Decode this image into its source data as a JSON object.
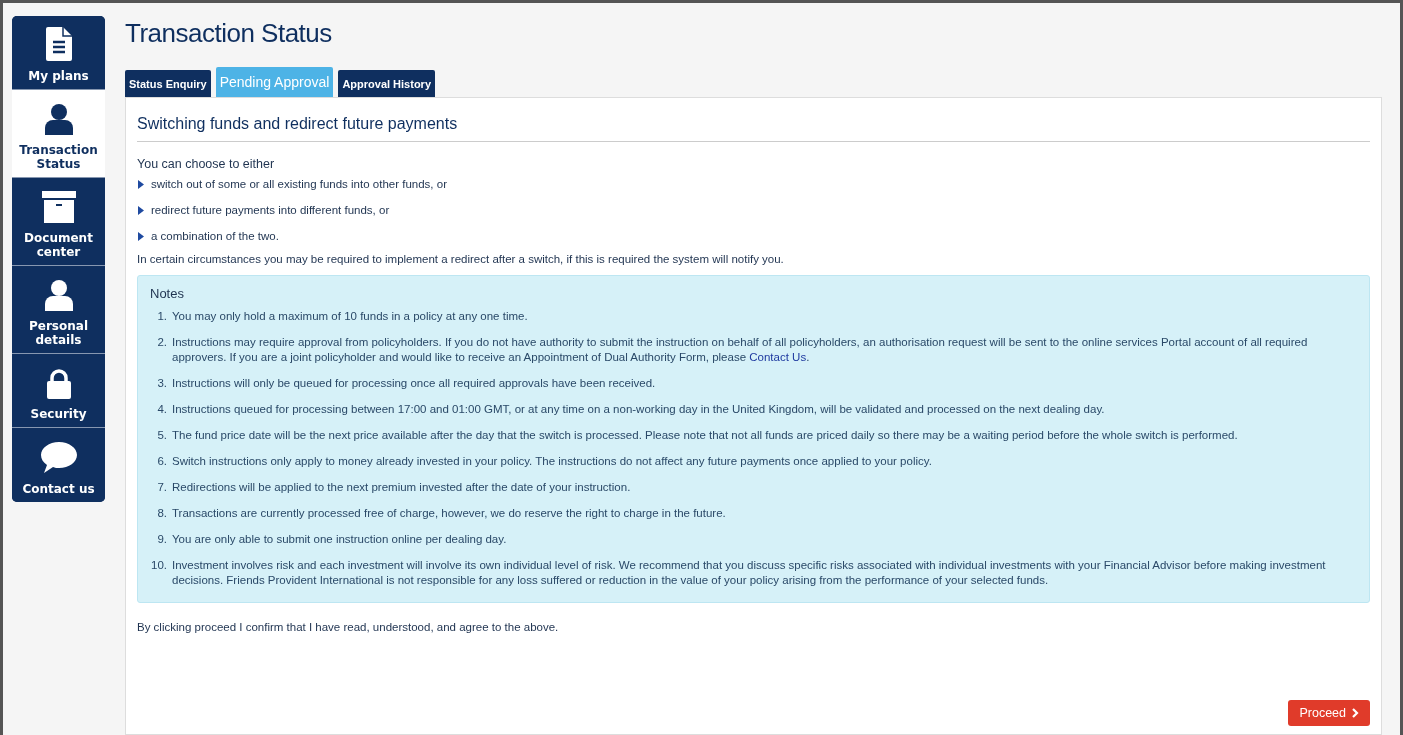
{
  "sidebar": {
    "items": [
      {
        "label": "My plans",
        "kind": "document",
        "selected": false
      },
      {
        "label": "Transaction Status",
        "kind": "person",
        "selected": true
      },
      {
        "label": "Document center",
        "kind": "archive",
        "selected": false
      },
      {
        "label": "Personal details",
        "kind": "person",
        "selected": false
      },
      {
        "label": "Security",
        "kind": "lock",
        "selected": false
      },
      {
        "label": "Contact us",
        "kind": "chat",
        "selected": false
      }
    ]
  },
  "page_title": "Transaction Status",
  "tabs": [
    {
      "label": "Status Enquiry",
      "selected": false
    },
    {
      "label": "Pending Approval",
      "selected": true
    },
    {
      "label": "Approval History",
      "selected": false
    }
  ],
  "panel": {
    "heading": "Switching funds and redirect future payments",
    "intro": "You can choose to either",
    "options": [
      "switch out of some or all existing funds into other funds, or",
      "redirect future payments into different funds, or",
      "a combination of the two."
    ],
    "circumstances": "In certain circumstances you may be required to implement a redirect after a switch, if this is required the system will notify you.",
    "notes": {
      "title": "Notes",
      "items": [
        {
          "number": "1.",
          "text": "You may only hold a maximum of 10 funds in a policy at any one time."
        },
        {
          "number": "2.",
          "text": "Instructions may require approval from policyholders. If you do not have authority to submit the instruction on behalf of all policyholders, an authorisation request will be sent to the online services Portal account of all required approvers. If you are a joint policyholder and would like to receive an Appointment of Dual Authority Form, please",
          "link": "Contact Us",
          "after": "."
        },
        {
          "number": "3.",
          "text": "Instructions will only be queued for processing once all required approvals have been received."
        },
        {
          "number": "4.",
          "text": "Instructions queued for processing between 17:00 and 01:00 GMT, or at any time on a non-working day in the United Kingdom, will be validated and processed on the next dealing day."
        },
        {
          "number": "5.",
          "text": "The fund price date will be the next price available after the day that the switch is processed. Please note that not all funds are priced daily so there may be a waiting period before the whole switch is performed."
        },
        {
          "number": "6.",
          "text": "Switch instructions only apply to money already invested in your policy. The instructions do not affect any future payments once applied to your policy."
        },
        {
          "number": "7.",
          "text": "Redirections will be applied to the next premium invested after the date of your instruction."
        },
        {
          "number": "8.",
          "text": "Transactions are currently processed free of charge, however, we do reserve the right to charge in the future."
        },
        {
          "number": "9.",
          "text": "You are only able to submit one instruction online per dealing day."
        },
        {
          "number": "10.",
          "text": "Investment involves risk and each investment will involve its own individual level of risk. We recommend that you discuss specific risks associated with individual investments with your Financial Advisor before making investment decisions. Friends Provident International is not responsible for any loss suffered or reduction in the value of your policy arising from the performance of your selected funds."
        }
      ]
    },
    "confirmation": "By clicking proceed I confirm that I have read, understood, and agree to the above.",
    "proceed_button": "Proceed"
  }
}
